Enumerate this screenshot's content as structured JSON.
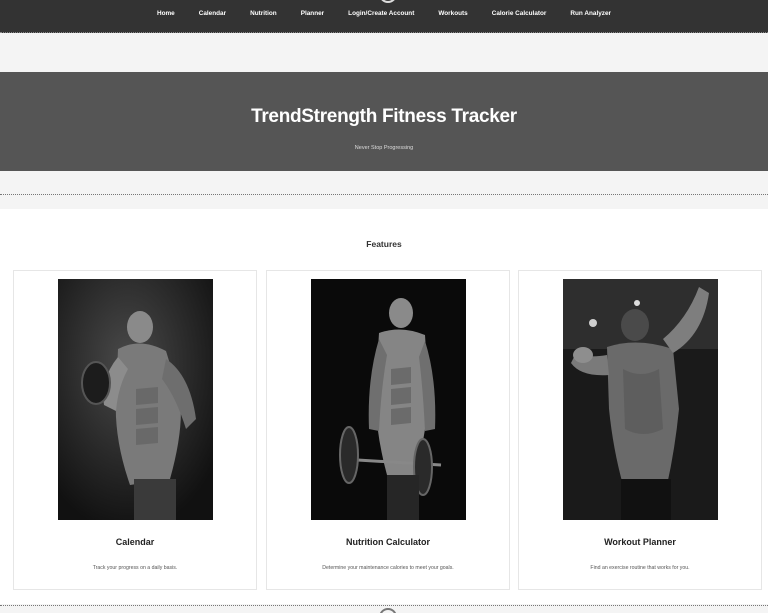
{
  "nav": {
    "items": [
      {
        "label": "Home"
      },
      {
        "label": "Calendar"
      },
      {
        "label": "Nutrition"
      },
      {
        "label": "Planner"
      },
      {
        "label": "Login/Create Account"
      },
      {
        "label": "Workouts"
      },
      {
        "label": "Calorie Calculator"
      },
      {
        "label": "Run Analyzer"
      }
    ]
  },
  "hero": {
    "title": "TrendStrength Fitness Tracker",
    "tagline": "Never Stop Progressing"
  },
  "features": {
    "heading": "Features",
    "cards": [
      {
        "title": "Calendar",
        "description": "Track your progress on a daily basis."
      },
      {
        "title": "Nutrition Calculator",
        "description": "Determine your maintenance calories to meet your goals."
      },
      {
        "title": "Workout Planner",
        "description": "Find an exercise routine that works for you."
      }
    ]
  }
}
